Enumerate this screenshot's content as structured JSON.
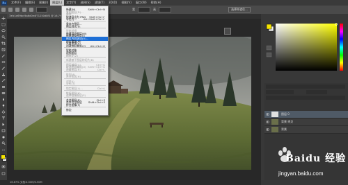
{
  "menubar": {
    "logo": "Ps",
    "items": [
      "文件(F)",
      "编辑(E)",
      "图像(I)",
      "图层(L)",
      "文字(Y)",
      "选择(S)",
      "滤镜(T)",
      "3D(D)",
      "视图(V)",
      "窗口(W)",
      "帮助(H)"
    ],
    "active_index": 3
  },
  "options": {
    "size_text": "宽",
    "swap_text": "高",
    "button_label": "选择并遮住..."
  },
  "tab": {
    "label": "7afc1d69bcf4a6d0e4f71250d8f3 @ 16.7% (RGB/8*)"
  },
  "dropdown": {
    "items": [
      {
        "label": "新建(N)",
        "shortcut": "Shift+Ctrl+N",
        "state": "normal"
      },
      {
        "label": "复制图层(D)...",
        "shortcut": "",
        "state": "disabled"
      },
      {
        "label": "删除",
        "shortcut": "",
        "state": "disabled"
      },
      {
        "label": "快速导出为 PNG",
        "shortcut": "Shift+Ctrl+'",
        "state": "normal"
      },
      {
        "label": "导出为...",
        "shortcut": "Alt+Shift+Ctrl+'",
        "state": "normal"
      },
      {
        "label": "SEP"
      },
      {
        "label": "重命名图层...",
        "shortcut": "",
        "state": "normal"
      },
      {
        "label": "图层样式(Y)",
        "shortcut": "",
        "state": "normal"
      },
      {
        "label": "SEP"
      },
      {
        "label": "智能滤镜",
        "shortcut": "",
        "state": "disabled"
      },
      {
        "label": "新建填充图层(W)",
        "shortcut": "",
        "state": "normal"
      },
      {
        "label": "新建调整图层(J)",
        "shortcut": "",
        "state": "normal"
      },
      {
        "label": "图层内容选项(O)...",
        "shortcut": "",
        "state": "highlighted"
      },
      {
        "label": "图层蒙版(M)",
        "shortcut": "",
        "state": "normal"
      },
      {
        "label": "矢量蒙版(V)",
        "shortcut": "",
        "state": "normal"
      },
      {
        "label": "创建剪贴蒙版(C)",
        "shortcut": "Alt+Ctrl+G",
        "state": "normal"
      },
      {
        "label": "SEP"
      },
      {
        "label": "智能对象",
        "shortcut": "",
        "state": "normal"
      },
      {
        "label": "视频图层",
        "shortcut": "",
        "state": "normal"
      },
      {
        "label": "栅格化(Z)",
        "shortcut": "",
        "state": "disabled"
      },
      {
        "label": "SEP"
      },
      {
        "label": "新建基于图层的切片(B)",
        "shortcut": "",
        "state": "disabled"
      },
      {
        "label": "SEP"
      },
      {
        "label": "图层编组(G)",
        "shortcut": "Ctrl+G",
        "state": "disabled"
      },
      {
        "label": "取消图层编组(U)",
        "shortcut": "Shift+Ctrl+G",
        "state": "disabled"
      },
      {
        "label": "隐藏图层(R)",
        "shortcut": "Ctrl+,",
        "state": "disabled"
      },
      {
        "label": "SEP"
      },
      {
        "label": "排列(A)",
        "shortcut": "",
        "state": "disabled"
      },
      {
        "label": "合并形状(H)",
        "shortcut": "",
        "state": "disabled"
      },
      {
        "label": "SEP"
      },
      {
        "label": "对齐(I)",
        "shortcut": "",
        "state": "disabled"
      },
      {
        "label": "分布(T)",
        "shortcut": "",
        "state": "disabled"
      },
      {
        "label": "SEP"
      },
      {
        "label": "锁定图层(L)...",
        "shortcut": "Ctrl+/",
        "state": "disabled"
      },
      {
        "label": "SEP"
      },
      {
        "label": "链接图层(K)",
        "shortcut": "",
        "state": "disabled"
      },
      {
        "label": "选择链接图层(S)",
        "shortcut": "",
        "state": "disabled"
      },
      {
        "label": "SEP"
      },
      {
        "label": "合并图层(E)",
        "shortcut": "Ctrl+E",
        "state": "normal"
      },
      {
        "label": "合并可见图层",
        "shortcut": "Shift+Ctrl+E",
        "state": "normal"
      },
      {
        "label": "拼合图像(F)",
        "shortcut": "",
        "state": "normal"
      },
      {
        "label": "SEP"
      },
      {
        "label": "修边",
        "shortcut": "",
        "state": "normal"
      }
    ]
  },
  "layers": {
    "rows": [
      {
        "name": "图层 0",
        "selected": true
      },
      {
        "name": "背景 拷贝",
        "selected": false
      },
      {
        "name": "背景",
        "selected": false
      }
    ]
  },
  "status": {
    "text": "16.67%   文档:4.50M/4.50M"
  },
  "watermark": {
    "title": "Baidu 经验",
    "url": "jingyan.baidu.com"
  },
  "colors": {
    "foreground": "#f5e400",
    "background": "#ffffff",
    "highlight": "#1e6fd6"
  }
}
